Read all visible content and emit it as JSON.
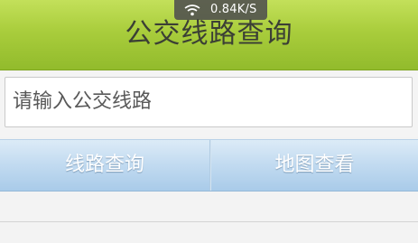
{
  "status_bar": {
    "network_speed": "0.84K/S",
    "icon": "wifi-icon"
  },
  "header": {
    "title": "公交线路查询"
  },
  "search": {
    "placeholder": "请输入公交线路",
    "value": ""
  },
  "buttons": {
    "query_label": "线路查询",
    "map_label": "地图查看"
  },
  "colors": {
    "header_green": "#a9cd3c",
    "button_blue": "#c1daf0",
    "button_text": "#ffffff"
  }
}
